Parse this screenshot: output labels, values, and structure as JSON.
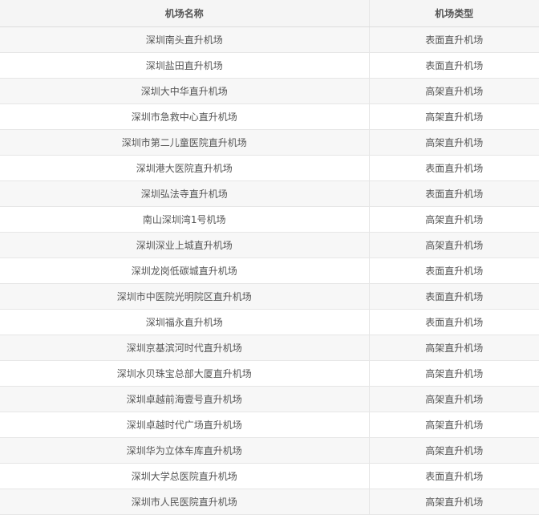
{
  "table": {
    "headers": [
      "机场名称",
      "机场类型"
    ],
    "rows": [
      [
        "深圳南头直升机场",
        "表面直升机场"
      ],
      [
        "深圳盐田直升机场",
        "表面直升机场"
      ],
      [
        "深圳大中华直升机场",
        "高架直升机场"
      ],
      [
        "深圳市急救中心直升机场",
        "高架直升机场"
      ],
      [
        "深圳市第二儿童医院直升机场",
        "高架直升机场"
      ],
      [
        "深圳港大医院直升机场",
        "表面直升机场"
      ],
      [
        "深圳弘法寺直升机场",
        "表面直升机场"
      ],
      [
        "南山深圳湾1号机场",
        "高架直升机场"
      ],
      [
        "深圳深业上城直升机场",
        "高架直升机场"
      ],
      [
        "深圳龙岗低碳城直升机场",
        "表面直升机场"
      ],
      [
        "深圳市中医院光明院区直升机场",
        "表面直升机场"
      ],
      [
        "深圳福永直升机场",
        "表面直升机场"
      ],
      [
        "深圳京基滨河时代直升机场",
        "高架直升机场"
      ],
      [
        "深圳水贝珠宝总部大厦直升机场",
        "高架直升机场"
      ],
      [
        "深圳卓越前海壹号直升机场",
        "高架直升机场"
      ],
      [
        "深圳卓越时代广场直升机场",
        "高架直升机场"
      ],
      [
        "深圳华为立体车库直升机场",
        "高架直升机场"
      ],
      [
        "深圳大学总医院直升机场",
        "表面直升机场"
      ],
      [
        "深圳市人民医院直升机场",
        "高架直升机场"
      ]
    ]
  }
}
